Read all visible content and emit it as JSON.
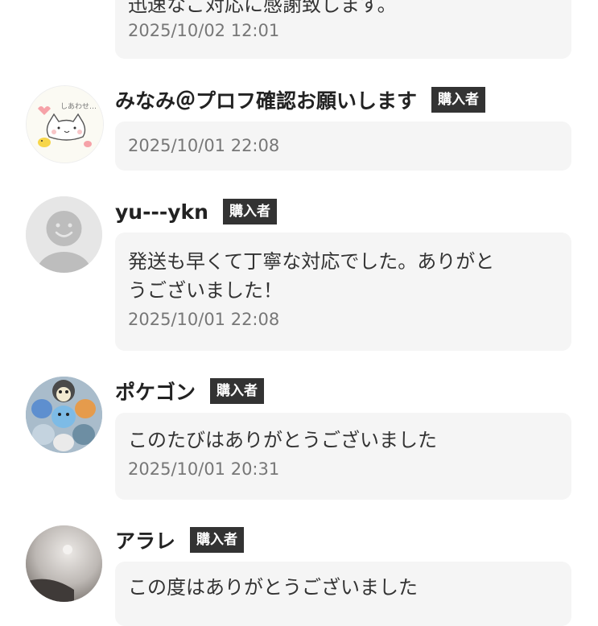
{
  "reviews": [
    {
      "name": "",
      "badge": "",
      "message": "迅速なご対応に感謝致します。",
      "date": "2025/10/02 12:01",
      "avatar": "none"
    },
    {
      "name": "みなみ＠プロフ確認お願いします",
      "badge": "購入者",
      "message": "",
      "date": "2025/10/01 22:08",
      "avatar": "cat-illustration"
    },
    {
      "name": "yu---ykn",
      "badge": "購入者",
      "message_lines": [
        "発送も早くて丁寧な対応でした。ありがと",
        "うございました！"
      ],
      "date": "2025/10/01 22:08",
      "avatar": "default-person"
    },
    {
      "name": "ポケゴン",
      "badge": "購入者",
      "message": "このたびはありがとうございました",
      "date": "2025/10/01 20:31",
      "avatar": "pokemon-group"
    },
    {
      "name": "アラレ",
      "badge": "購入者",
      "message": "この度はありがとうございました",
      "date": "",
      "avatar": "photo"
    }
  ]
}
